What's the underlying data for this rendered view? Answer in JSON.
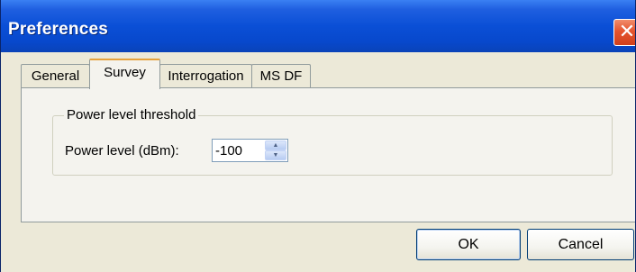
{
  "window": {
    "title": "Preferences",
    "close_glyph": "✕",
    "close_icon": "close-icon"
  },
  "tabs": [
    {
      "label": "General",
      "active": false
    },
    {
      "label": "Survey",
      "active": true
    },
    {
      "label": "Interrogation",
      "active": false
    },
    {
      "label": "MS DF",
      "active": false
    }
  ],
  "survey": {
    "group_title": "Power level threshold",
    "power_label": "Power level (dBm):",
    "power_value": "-100",
    "spin_up_glyph": "▲",
    "spin_down_glyph": "▼"
  },
  "buttons": {
    "ok": "OK",
    "cancel": "Cancel"
  },
  "colors": {
    "title_bar": "#0a4fd6",
    "close_button": "#e5542e",
    "dialog_face": "#ece9d8",
    "active_tab_highlight": "#e6a23c"
  }
}
